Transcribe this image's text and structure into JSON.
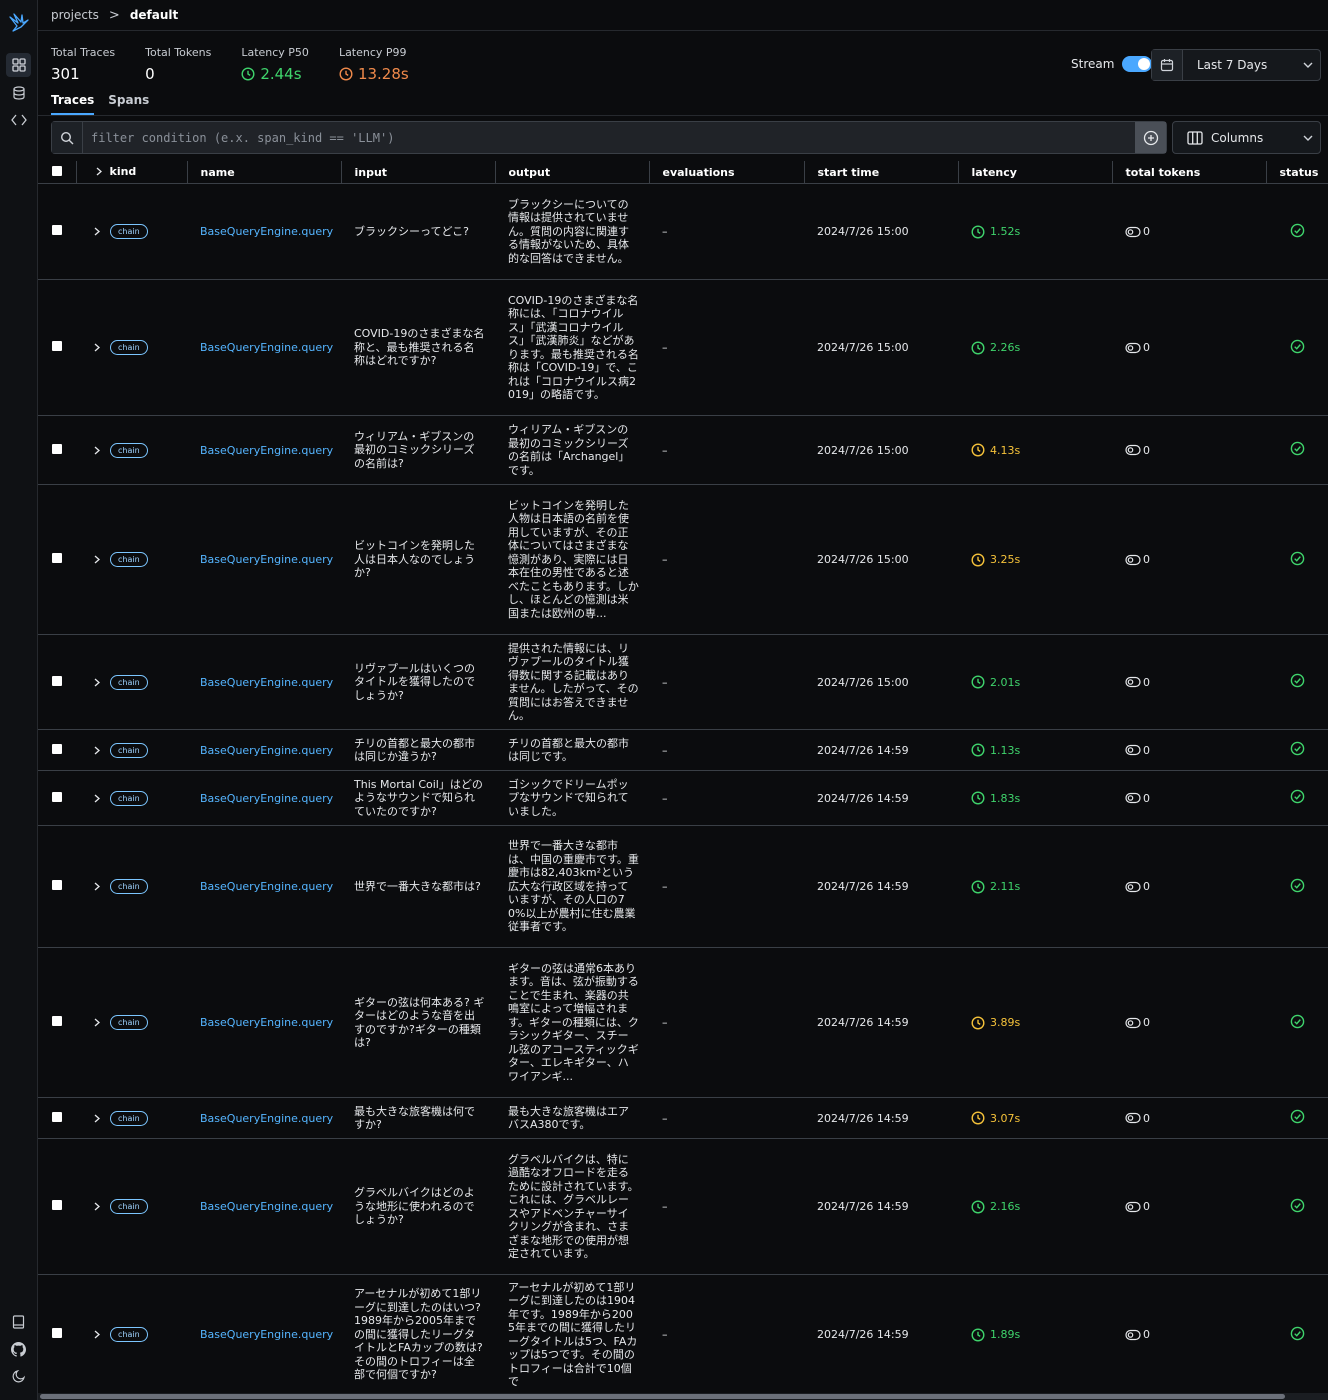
{
  "breadcrumb": {
    "projects": "projects",
    "separator": ">",
    "current": "default"
  },
  "stats": [
    {
      "label": "Total Traces",
      "value": "301",
      "kind": "plain"
    },
    {
      "label": "Total Tokens",
      "value": "0",
      "kind": "plain"
    },
    {
      "label": "Latency P50",
      "value": "2.44s",
      "kind": "p50"
    },
    {
      "label": "Latency P99",
      "value": "13.28s",
      "kind": "p99"
    }
  ],
  "stream": {
    "label": "Stream",
    "enabled": true
  },
  "date_range": {
    "value": "Last 7 Days"
  },
  "tabs": [
    {
      "label": "Traces",
      "active": true
    },
    {
      "label": "Spans",
      "active": false
    }
  ],
  "filter": {
    "placeholder": "filter condition (e.x. span_kind == 'LLM')",
    "value": ""
  },
  "columns_button": "Columns",
  "colors": {
    "accent": "#4aa8ff",
    "link": "#55b5ff",
    "ok": "#3fd46c",
    "warn": "#f5c23a",
    "p99": "#f08a4b"
  },
  "table": {
    "headers": {
      "kind": "kind",
      "name": "name",
      "input": "input",
      "output": "output",
      "evaluations": "evaluations",
      "start_time": "start time",
      "latency": "latency",
      "total_tokens": "total tokens",
      "status": "status"
    },
    "rows": [
      {
        "kind": "chain",
        "name": "BaseQueryEngine.query",
        "input": "ブラックシーってどこ?",
        "output": "ブラックシーについての情報は提供されていません。質問の内容に関連する情報がないため、具体的な回答はできません。",
        "evaluations": "–",
        "start_time": "2024/7/26 15:00",
        "latency": "1.52s",
        "latency_level": "ok",
        "tokens": "0",
        "status": "ok"
      },
      {
        "kind": "chain",
        "name": "BaseQueryEngine.query",
        "input": "COVID-19のさまざまな名称と、最も推奨される名称はどれですか?",
        "output": "COVID-19のさまざまな名称には、「コロナウイルス」「武漢コロナウイルス」「武漢肺炎」などがあります。最も推奨される名称は「COVID-19」で、これは「コロナウイルス病2019」の略語です。",
        "evaluations": "–",
        "start_time": "2024/7/26 15:00",
        "latency": "2.26s",
        "latency_level": "ok",
        "tokens": "0",
        "status": "ok"
      },
      {
        "kind": "chain",
        "name": "BaseQueryEngine.query",
        "input": "ウィリアム・ギブスンの最初のコミックシリーズの名前は?",
        "output": "ウィリアム・ギブスンの最初のコミックシリーズの名前は「Archangel」です。",
        "evaluations": "–",
        "start_time": "2024/7/26 15:00",
        "latency": "4.13s",
        "latency_level": "warn",
        "tokens": "0",
        "status": "ok"
      },
      {
        "kind": "chain",
        "name": "BaseQueryEngine.query",
        "input": "ビットコインを発明した人は日本人なのでしょうか?",
        "output": "ビットコインを発明した人物は日本語の名前を使用していますが、その正体についてはさまざまな憶測があり、実際には日本在住の男性であると述べたこともあります。しかし、ほとんどの憶測は米国または欧州の専...",
        "evaluations": "–",
        "start_time": "2024/7/26 15:00",
        "latency": "3.25s",
        "latency_level": "warn",
        "tokens": "0",
        "status": "ok"
      },
      {
        "kind": "chain",
        "name": "BaseQueryEngine.query",
        "input": "リヴァプールはいくつのタイトルを獲得したのでしょうか?",
        "output": "提供された情報には、リヴァプールのタイトル獲得数に関する記載はありません。したがって、その質問にはお答えできません。",
        "evaluations": "–",
        "start_time": "2024/7/26 15:00",
        "latency": "2.01s",
        "latency_level": "ok",
        "tokens": "0",
        "status": "ok"
      },
      {
        "kind": "chain",
        "name": "BaseQueryEngine.query",
        "input": "チリの首都と最大の都市は同じか違うか?",
        "output": "チリの首都と最大の都市は同じです。",
        "evaluations": "–",
        "start_time": "2024/7/26 14:59",
        "latency": "1.13s",
        "latency_level": "ok",
        "tokens": "0",
        "status": "ok"
      },
      {
        "kind": "chain",
        "name": "BaseQueryEngine.query",
        "input": "This Mortal Coil」はどのようなサウンドで知られていたのですか?",
        "output": "ゴシックでドリームポップなサウンドで知られていました。",
        "evaluations": "–",
        "start_time": "2024/7/26 14:59",
        "latency": "1.83s",
        "latency_level": "ok",
        "tokens": "0",
        "status": "ok"
      },
      {
        "kind": "chain",
        "name": "BaseQueryEngine.query",
        "input": "世界で一番大きな都市は?",
        "output": "世界で一番大きな都市は、中国の重慶市です。重慶市は82,403km²という広大な行政区域を持っていますが、その人口の70%以上が農村に住む農業従事者です。",
        "evaluations": "–",
        "start_time": "2024/7/26 14:59",
        "latency": "2.11s",
        "latency_level": "ok",
        "tokens": "0",
        "status": "ok"
      },
      {
        "kind": "chain",
        "name": "BaseQueryEngine.query",
        "input": "ギターの弦は何本ある? ギターはどのような音を出すのですか?ギターの種類は?",
        "output": "ギターの弦は通常6本あります。音は、弦が振動することで生まれ、楽器の共鳴室によって増幅されます。ギターの種類には、クラシックギター、スチール弦のアコースティックギター、エレキギター、ハワイアンギ...",
        "evaluations": "–",
        "start_time": "2024/7/26 14:59",
        "latency": "3.89s",
        "latency_level": "warn",
        "tokens": "0",
        "status": "ok"
      },
      {
        "kind": "chain",
        "name": "BaseQueryEngine.query",
        "input": "最も大きな旅客機は何ですか?",
        "output": "最も大きな旅客機はエアバスA380です。",
        "evaluations": "–",
        "start_time": "2024/7/26 14:59",
        "latency": "3.07s",
        "latency_level": "warn",
        "tokens": "0",
        "status": "ok"
      },
      {
        "kind": "chain",
        "name": "BaseQueryEngine.query",
        "input": "グラベルバイクはどのような地形に使われるのでしょうか?",
        "output": "グラベルバイクは、特に過酷なオフロードを走るために設計されています。これには、グラベルレースやアドベンチャーサイクリングが含まれ、さまざまな地形での使用が想定されています。",
        "evaluations": "–",
        "start_time": "2024/7/26 14:59",
        "latency": "2.16s",
        "latency_level": "ok",
        "tokens": "0",
        "status": "ok"
      },
      {
        "kind": "chain",
        "name": "BaseQueryEngine.query",
        "input": "アーセナルが初めて1部リーグに到達したのはいつ?1989年から2005年までの間に獲得したリーグタイトルとFAカップの数は?その間のトロフィーは全部で何個ですか?",
        "output": "アーセナルが初めて1部リーグに到達したのは1904年です。1989年から2005年までの間に獲得したリーグタイトルは5つ、FAカップは5つです。その間のトロフィーは合計で10個で",
        "evaluations": "–",
        "start_time": "2024/7/26 14:59",
        "latency": "1.89s",
        "latency_level": "ok",
        "tokens": "0",
        "status": "ok"
      }
    ]
  }
}
